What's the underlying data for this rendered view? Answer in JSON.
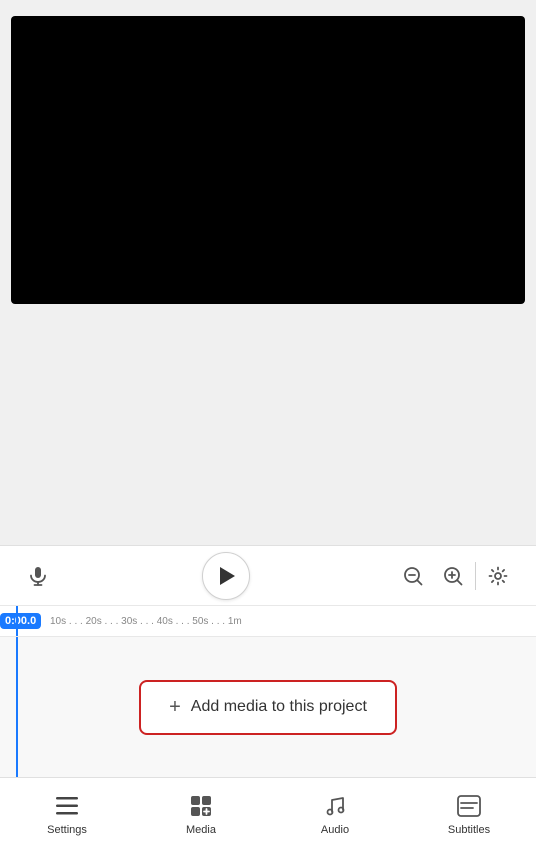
{
  "video": {
    "preview_label": "Video Preview"
  },
  "transport": {
    "mic_label": "Microphone",
    "play_label": "Play",
    "zoom_out_label": "Zoom Out",
    "zoom_in_label": "Zoom In",
    "settings_label": "Settings"
  },
  "timeline": {
    "current_time": "0:00.0",
    "ticks": "10s . . . 20s . . . 30s . . . 40s . . . 50s . . . 1m",
    "add_media_label": "Add media to this project"
  },
  "bottom_nav": {
    "items": [
      {
        "id": "settings",
        "label": "Settings",
        "icon": "☰"
      },
      {
        "id": "media",
        "label": "Media",
        "icon": "⊞"
      },
      {
        "id": "audio",
        "label": "Audio",
        "icon": "♩"
      },
      {
        "id": "subtitles",
        "label": "Subtitles",
        "icon": "▤"
      }
    ]
  }
}
